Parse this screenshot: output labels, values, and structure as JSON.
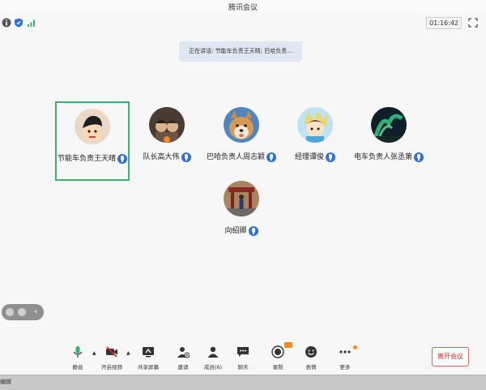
{
  "window": {
    "title": "腾讯会议"
  },
  "topbar": {
    "timer": "01:16:42"
  },
  "speaking": {
    "text": "正在讲话: 节能车负责王天晴; 巴哈负责..."
  },
  "participants": [
    {
      "name": "节能车负责王天晴",
      "active": true
    },
    {
      "name": "队长高大伟",
      "active": false
    },
    {
      "name": "巴哈负责人周志颖",
      "active": false
    },
    {
      "name": "经理谭俊",
      "active": false
    },
    {
      "name": "电车负责人张丞第",
      "active": false
    },
    {
      "name": "向绍卿",
      "active": false
    }
  ],
  "toolbar": {
    "mute": "静音",
    "video": "开启视频",
    "share": "共享屏幕",
    "invite": "邀请",
    "members": "成员(6)",
    "chat": "聊天",
    "record": "录制",
    "reaction": "表情",
    "more": "更多",
    "leave": "离开会议"
  },
  "taskbar": {
    "label": "编辑"
  },
  "colors": {
    "accent": "#2f6fe0",
    "active_border": "#39b36b",
    "leave": "#d22222",
    "badge": "#f08a24"
  }
}
